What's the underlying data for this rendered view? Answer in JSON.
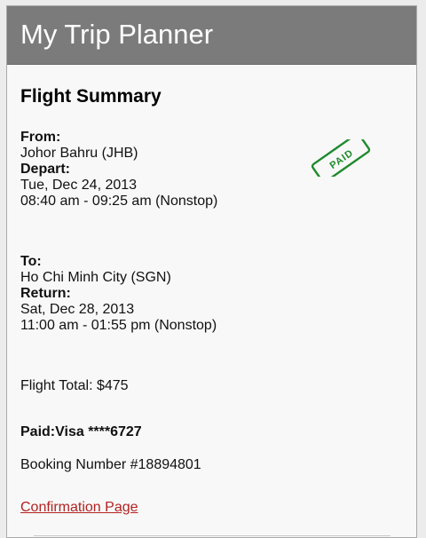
{
  "header": {
    "title": "My Trip Planner"
  },
  "summary": {
    "title": "Flight Summary",
    "stamp_text": "PAID",
    "stamp_color": "#1e8a2c",
    "from_label": "From:",
    "from_value": "Johor Bahru (JHB)",
    "depart_label": "Depart:",
    "depart_date": "Tue, Dec 24, 2013",
    "depart_time": "08:40 am - 09:25 am (Nonstop)",
    "to_label": "To:",
    "to_value": "Ho Chi Minh City (SGN)",
    "return_label": "Return:",
    "return_date": "Sat, Dec 28, 2013",
    "return_time": "11:00 am - 01:55 pm (Nonstop)",
    "total": "Flight Total: $475",
    "paid": "Paid:Visa ****6727",
    "booking": "Booking Number #18894801",
    "confirmation_link": "Confirmation Page"
  }
}
